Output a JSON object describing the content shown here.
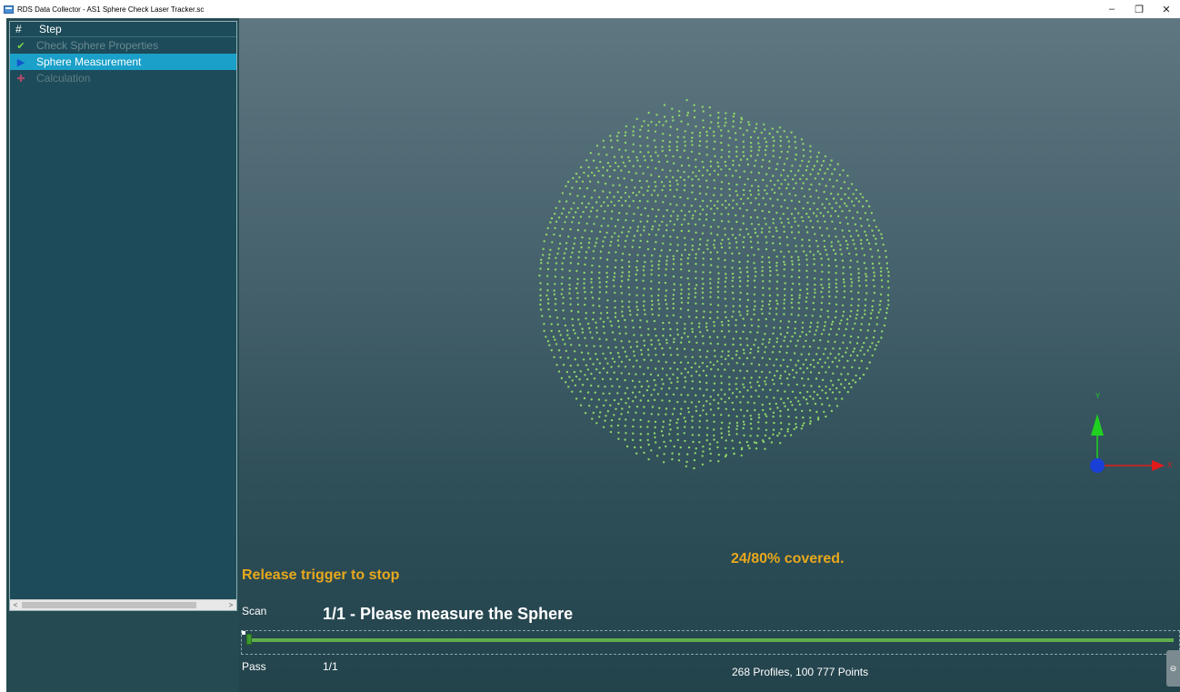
{
  "window": {
    "title": "RDS Data Collector - AS1 Sphere Check Laser Tracker.sc",
    "controls": {
      "minimize": "–",
      "restore": "❐",
      "close": "✕"
    }
  },
  "step_panel": {
    "header": {
      "num": "#",
      "step": "Step"
    },
    "steps": [
      {
        "label": "Check Sphere Properties",
        "state": "done",
        "icon": "✔"
      },
      {
        "label": "Sphere Measurement",
        "state": "active",
        "icon": "▶"
      },
      {
        "label": "Calculation",
        "state": "pending",
        "icon": "✚"
      }
    ],
    "scroll_left": "<",
    "scroll_right": ">"
  },
  "viewport": {
    "coverage": "24/80% covered.",
    "instruction": "Release trigger to stop",
    "scan_label": "Scan",
    "scan_message": "1/1 - Please measure the Sphere",
    "pass_label": "Pass",
    "pass_value": "1/1",
    "points_summary": "268 Profiles, 100 777 Points",
    "axis_labels": {
      "x": "X",
      "y": "Y"
    },
    "colors": {
      "point_cloud": "#8fd56a",
      "status_text": "#e8a81c",
      "axis_x": "#e01b1b",
      "axis_y": "#20d020",
      "axis_origin": "#1a3fd6"
    }
  }
}
